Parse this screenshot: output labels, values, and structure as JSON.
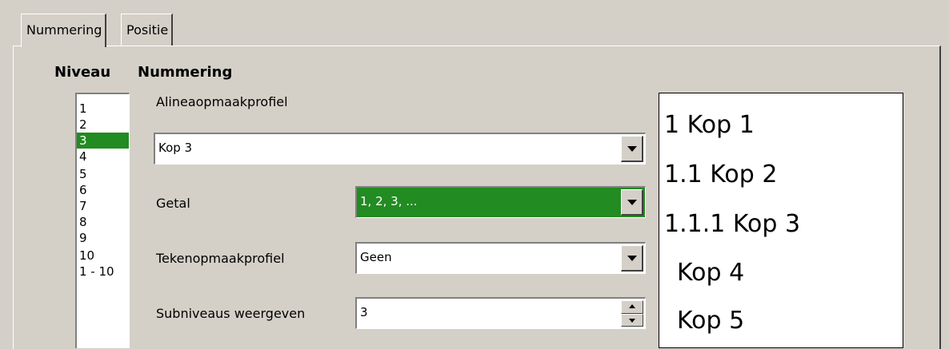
{
  "tabs": [
    {
      "label": "Nummering",
      "active": true
    },
    {
      "label": "Positie",
      "active": false
    }
  ],
  "headings": {
    "level": "Niveau",
    "numbering": "Nummering"
  },
  "levels": {
    "items": [
      "1",
      "2",
      "3",
      "4",
      "5",
      "6",
      "7",
      "8",
      "9",
      "10",
      "1 - 10"
    ],
    "selected": "3"
  },
  "fields": {
    "paragraph_style_label": "Alineaopmaakprofiel",
    "paragraph_style_value": "Kop 3",
    "number_label": "Getal",
    "number_value": "1, 2, 3, ...",
    "char_style_label": "Tekenopmaakprofiel",
    "char_style_value": "Geen",
    "sublevels_label": "Subniveaus weergeven",
    "sublevels_value": "3"
  },
  "preview": [
    "1 Kop 1",
    "1.1 Kop 2",
    "1.1.1 Kop 3",
    "Kop 4",
    "Kop 5"
  ],
  "colors": {
    "selection": "#228b22",
    "dialog_bg": "#d4d0c8"
  }
}
